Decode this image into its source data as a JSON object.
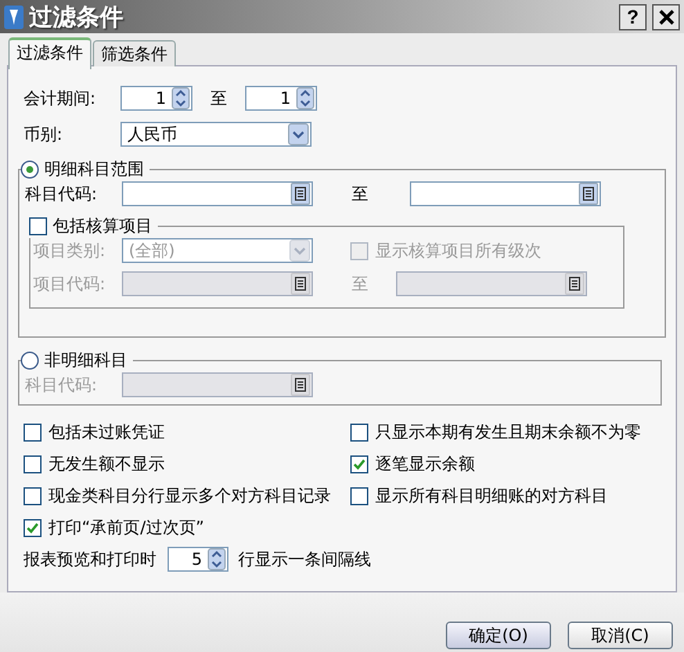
{
  "window": {
    "title": "过滤条件",
    "help": "?"
  },
  "tabs": [
    {
      "label": "过滤条件",
      "selected": true
    },
    {
      "label": "筛选条件",
      "selected": false
    }
  ],
  "period": {
    "label": "会计期间:",
    "from": "1",
    "separator": "至",
    "to": "1"
  },
  "currency": {
    "label": "币别:",
    "value": "人民币"
  },
  "detail_range": {
    "label": "明细科目范围",
    "selected": true,
    "account_code": {
      "label": "科目代码:",
      "separator": "至"
    },
    "include_items": {
      "label": "包括核算项目",
      "checked": false,
      "item_type": {
        "label": "项目类别:",
        "value": "(全部)",
        "disabled": true
      },
      "show_all_levels": {
        "label": "显示核算项目所有级次",
        "checked": false,
        "disabled": true
      },
      "item_code": {
        "label": "项目代码:",
        "separator": "至",
        "disabled": true
      }
    }
  },
  "non_detail": {
    "label": "非明细科目",
    "selected": false,
    "account_code": {
      "label": "科目代码:",
      "disabled": true
    }
  },
  "options": [
    {
      "label": "包括未过账凭证",
      "checked": false
    },
    {
      "label": "只显示本期有发生且期末余额不为零",
      "checked": false
    },
    {
      "label": "无发生额不显示",
      "checked": false
    },
    {
      "label": "逐笔显示余额",
      "checked": true
    },
    {
      "label": "现金类科目分行显示多个对方科目记录",
      "checked": false
    },
    {
      "label": "显示所有科目明细账的对方科目",
      "checked": false
    },
    {
      "label": "打印“承前页/过次页”",
      "checked": true
    }
  ],
  "interval": {
    "before": "报表预览和打印时",
    "value": "5",
    "after": "行显示一条间隔线"
  },
  "buttons": [
    "确定(O)",
    "取消(C)"
  ]
}
